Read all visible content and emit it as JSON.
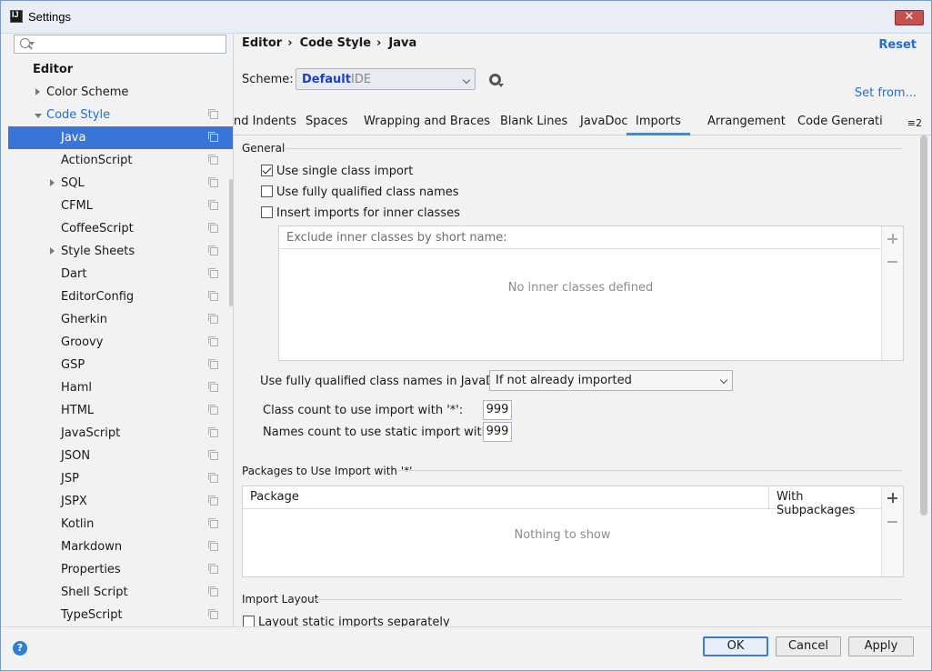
{
  "window": {
    "title": "Settings"
  },
  "sidebar": {
    "search_placeholder": "",
    "items": [
      {
        "label": "Editor",
        "indent": 0,
        "bold": true,
        "arrow": "none",
        "copy": false
      },
      {
        "label": "Color Scheme",
        "indent": 1,
        "arrow": "right",
        "copy": false
      },
      {
        "label": "Code Style",
        "indent": 1,
        "arrow": "down",
        "copy": true,
        "link": true
      },
      {
        "label": "Java",
        "indent": 2,
        "arrow": "none",
        "copy": true,
        "selected": true
      },
      {
        "label": "ActionScript",
        "indent": 2,
        "arrow": "none",
        "copy": true
      },
      {
        "label": "SQL",
        "indent": 2,
        "arrow": "right",
        "copy": true
      },
      {
        "label": "CFML",
        "indent": 2,
        "arrow": "none",
        "copy": true
      },
      {
        "label": "CoffeeScript",
        "indent": 2,
        "arrow": "none",
        "copy": true
      },
      {
        "label": "Style Sheets",
        "indent": 2,
        "arrow": "right",
        "copy": true
      },
      {
        "label": "Dart",
        "indent": 2,
        "arrow": "none",
        "copy": true
      },
      {
        "label": "EditorConfig",
        "indent": 2,
        "arrow": "none",
        "copy": true
      },
      {
        "label": "Gherkin",
        "indent": 2,
        "arrow": "none",
        "copy": true
      },
      {
        "label": "Groovy",
        "indent": 2,
        "arrow": "none",
        "copy": true
      },
      {
        "label": "GSP",
        "indent": 2,
        "arrow": "none",
        "copy": true
      },
      {
        "label": "Haml",
        "indent": 2,
        "arrow": "none",
        "copy": true
      },
      {
        "label": "HTML",
        "indent": 2,
        "arrow": "none",
        "copy": true
      },
      {
        "label": "JavaScript",
        "indent": 2,
        "arrow": "none",
        "copy": true
      },
      {
        "label": "JSON",
        "indent": 2,
        "arrow": "none",
        "copy": true
      },
      {
        "label": "JSP",
        "indent": 2,
        "arrow": "none",
        "copy": true
      },
      {
        "label": "JSPX",
        "indent": 2,
        "arrow": "none",
        "copy": true
      },
      {
        "label": "Kotlin",
        "indent": 2,
        "arrow": "none",
        "copy": true
      },
      {
        "label": "Markdown",
        "indent": 2,
        "arrow": "none",
        "copy": true
      },
      {
        "label": "Properties",
        "indent": 2,
        "arrow": "none",
        "copy": true
      },
      {
        "label": "Shell Script",
        "indent": 2,
        "arrow": "none",
        "copy": true
      },
      {
        "label": "TypeScript",
        "indent": 2,
        "arrow": "none",
        "copy": true
      }
    ]
  },
  "header": {
    "breadcrumb": [
      "Editor",
      "Code Style",
      "Java"
    ],
    "reset": "Reset",
    "scheme_label": "Scheme:",
    "scheme_name": "Default",
    "scheme_type": "IDE",
    "set_from": "Set from..."
  },
  "tabs": [
    {
      "label": "nd Indents"
    },
    {
      "label": "Spaces"
    },
    {
      "label": "Wrapping and Braces"
    },
    {
      "label": "Blank Lines"
    },
    {
      "label": "JavaDoc"
    },
    {
      "label": "Imports",
      "active": true
    },
    {
      "label": "Arrangement"
    },
    {
      "label": "Code Generati"
    }
  ],
  "more_tabs": "≡2",
  "imports": {
    "general_title": "General",
    "checkboxes": [
      {
        "label": "Use single class import",
        "checked": true
      },
      {
        "label": "Use fully qualified class names",
        "checked": false
      },
      {
        "label": "Insert imports for inner classes",
        "checked": false
      }
    ],
    "exclude_header": "Exclude inner classes by short name:",
    "exclude_empty": "No inner classes defined",
    "fq_javadoc_label": "Use fully qualified class names in JavaDoc:",
    "fq_javadoc_value": "If not already imported",
    "class_count_label": "Class count to use import with '*':",
    "class_count_value": "999",
    "names_count_label": "Names count to use static import with '*':",
    "names_count_value": "999",
    "packages_title": "Packages to Use Import with '*'",
    "packages_col1": "Package",
    "packages_col2": "With Subpackages",
    "packages_empty": "Nothing to show",
    "layout_title": "Import Layout",
    "layout_static_label": "Layout static imports separately"
  },
  "footer": {
    "help": "?",
    "ok": "OK",
    "cancel": "Cancel",
    "apply": "Apply"
  }
}
